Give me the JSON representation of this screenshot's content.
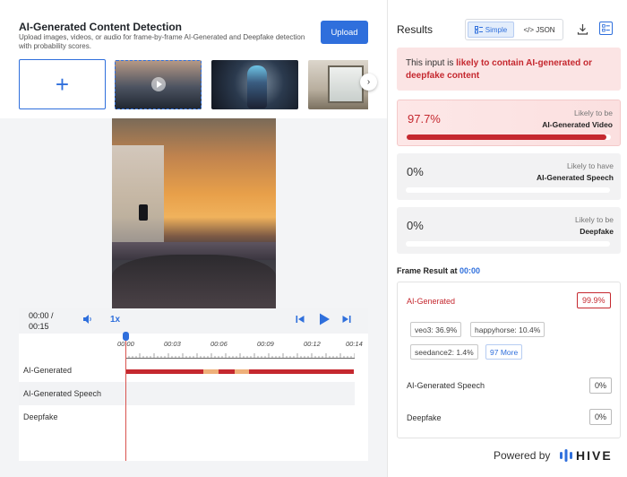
{
  "header": {
    "title": "AI-Generated Content Detection",
    "subtitle": "Upload images, videos, or audio for frame-by-frame AI-Generated and Deepfake detection with probability scores.",
    "upload_label": "Upload",
    "add_icon": "plus-icon",
    "next_icon": "chevron-right-icon"
  },
  "player": {
    "time_current": "00:00 /",
    "time_total": "00:15",
    "speed": "1x",
    "timeline_ticks": [
      "00:00",
      "00:03",
      "00:06",
      "00:09",
      "00:12",
      "00:14"
    ],
    "tracks": [
      {
        "label": "AI-Generated"
      },
      {
        "label": "AI-Generated Speech"
      },
      {
        "label": "Deepfake"
      }
    ],
    "colors": {
      "ai_bar": "#c5282f",
      "warn_bar": "#efb07a",
      "playhead": "#d9534f"
    }
  },
  "results": {
    "title": "Results",
    "view_simple": "Simple",
    "view_json": "</> JSON",
    "alert_prefix": "This input is ",
    "alert_highlight": "likely to contain AI-generated or deepfake content",
    "cards": [
      {
        "pct": "97.7%",
        "line1": "Likely to be",
        "line2": "AI-Generated Video",
        "value": 0.977
      },
      {
        "pct": "0%",
        "line1": "Likely to have",
        "line2": "AI-Generated Speech",
        "value": 0
      },
      {
        "pct": "0%",
        "line1": "Likely to be",
        "line2": "Deepfake",
        "value": 0
      }
    ],
    "frame_title": "Frame Result at ",
    "frame_time": "00:00",
    "frame": {
      "ai_label": "AI-Generated",
      "ai_value": "99.9%",
      "chips": [
        "veo3: 36.9%",
        "happyhorse: 10.4%",
        "seedance2: 1.4%"
      ],
      "more": "97 More",
      "speech_label": "AI-Generated Speech",
      "speech_value": "0%",
      "deepfake_label": "Deepfake",
      "deepfake_value": "0%"
    },
    "powered_by": "Powered by",
    "brand": "HIVE"
  }
}
